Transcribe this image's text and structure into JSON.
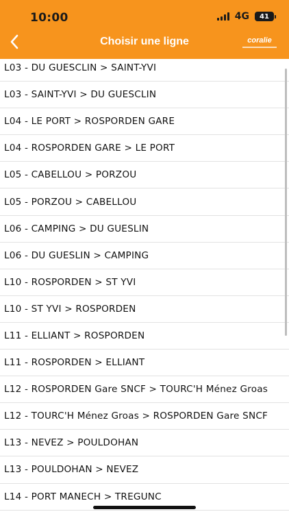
{
  "status_bar": {
    "time": "10:00",
    "network": "4G",
    "battery": "41"
  },
  "header": {
    "title": "Choisir une ligne",
    "logo": "coralie",
    "back_icon": "chevron-left-icon",
    "background_color": "#f7941d"
  },
  "lines": [
    "L03 - DU GUESCLIN > SAINT-YVI",
    "L03 - SAINT-YVI > DU GUESCLIN",
    "L04 - LE PORT > ROSPORDEN GARE",
    "L04 - ROSPORDEN GARE > LE PORT",
    "L05 - CABELLOU >  PORZOU",
    "L05 - PORZOU > CABELLOU",
    "L06 - CAMPING > DU GUESLIN",
    "L06 - DU GUESLIN > CAMPING",
    "L10 - ROSPORDEN > ST YVI",
    "L10 - ST YVI > ROSPORDEN",
    "L11 - ELLIANT > ROSPORDEN",
    "L11 - ROSPORDEN > ELLIANT",
    "L12 - ROSPORDEN Gare SNCF > TOURC'H Ménez Groas",
    "L12 - TOURC'H Ménez Groas > ROSPORDEN Gare SNCF",
    "L13 - NEVEZ > POULDOHAN",
    "L13 - POULDOHAN > NEVEZ",
    "L14 - PORT MANECH > TREGUNC"
  ]
}
